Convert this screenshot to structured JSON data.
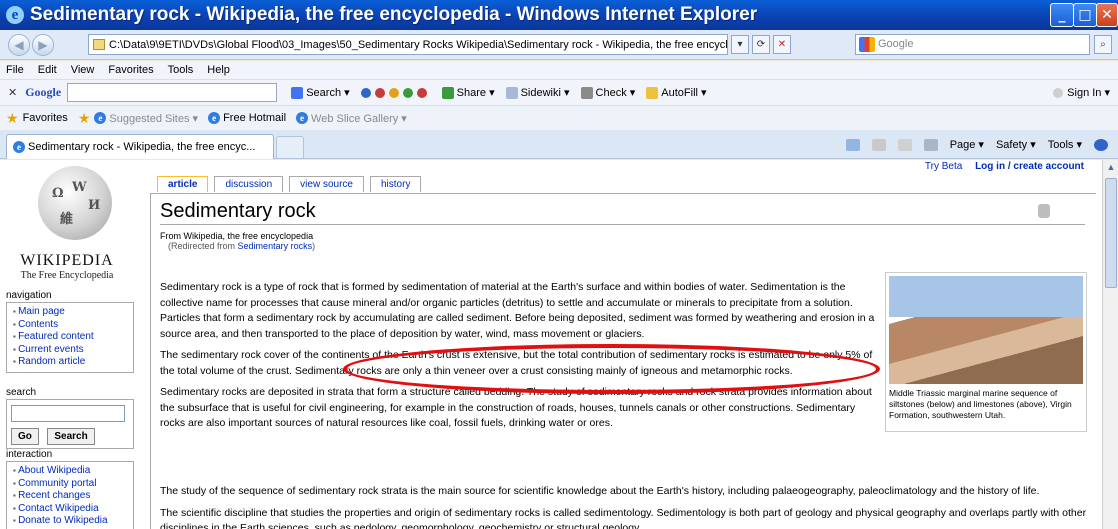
{
  "window": {
    "title": "Sedimentary rock - Wikipedia, the free encyclopedia - Windows Internet Explorer"
  },
  "address": {
    "url": "C:\\Data\\9\\9ETI\\DVDs\\Global Flood\\03_Images\\50_Sedimentary Rocks Wikipedia\\Sedimentary rock - Wikipedia, the free encyclopedia.mh",
    "search_placeholder": "Google"
  },
  "menu": [
    "File",
    "Edit",
    "View",
    "Favorites",
    "Tools",
    "Help"
  ],
  "google_toolbar": {
    "label": "Google",
    "items": [
      "Search ▾",
      "Share ▾",
      "Sidewiki ▾",
      "Check ▾",
      "AutoFill ▾",
      "Sign In ▾"
    ]
  },
  "favorites": {
    "label": "Favorites",
    "items": [
      "Suggested Sites ▾",
      "Free Hotmail",
      "Web Slice Gallery ▾"
    ]
  },
  "tab": {
    "title": "Sedimentary rock - Wikipedia, the free encyc..."
  },
  "commands": [
    "Page ▾",
    "Safety ▾",
    "Tools ▾"
  ],
  "wiki": {
    "wordmark": "WIKIPEDIA",
    "tagline": "The Free Encyclopedia",
    "navigation_title": "navigation",
    "navigation": [
      "Main page",
      "Contents",
      "Featured content",
      "Current events",
      "Random article"
    ],
    "search_title": "search",
    "go": "Go",
    "search": "Search",
    "interaction_title": "interaction",
    "interaction": [
      "About Wikipedia",
      "Community portal",
      "Recent changes",
      "Contact Wikipedia",
      "Donate to Wikipedia"
    ],
    "tabs": [
      "article",
      "discussion",
      "view source",
      "history"
    ],
    "try_beta": "Try Beta",
    "login": "Log in / create account",
    "title": "Sedimentary rock",
    "from": "From Wikipedia, the free encyclopedia",
    "redirect_prefix": "(Redirected from",
    "redirect_link": "Sedimentary rocks",
    "caption": "Middle Triassic marginal marine sequence of siltstones (below) and limestones (above), Virgin Formation, southwestern Utah.",
    "paragraphs": [
      "Sedimentary rock is a type of rock that is formed by sedimentation of material at the Earth's surface and within bodies of water. Sedimentation is the collective name for processes that cause mineral and/or organic particles (detritus) to settle and accumulate or minerals to precipitate from a solution. Particles that form a sedimentary rock by accumulating are called sediment. Before being deposited, sediment was formed by weathering and erosion in a source area, and then transported to the place of deposition by water, wind, mass movement or glaciers.",
      "The sedimentary rock cover of the continents of the Earth's crust is extensive, but the total contribution of sedimentary rocks is estimated to be only 5% of the total volume of the crust. Sedimentary rocks are only a thin veneer over a crust consisting mainly of igneous and metamorphic rocks.",
      "Sedimentary rocks are deposited in strata that form a structure called bedding. The study of sedimentary rocks and rock strata provides information about the subsurface that is useful for civil engineering, for example in the construction of roads, houses, tunnels canals or other constructions. Sedimentary rocks are also important sources of natural resources like coal, fossil fuels, drinking water or ores.",
      "The study of the sequence of sedimentary rock strata is the main source for scientific knowledge about the Earth's history, including palaeogeography, paleoclimatology and the history of life.",
      "The scientific discipline that studies the properties and origin of sedimentary rocks is called sedimentology. Sedimentology is both part of geology and physical geography and overlaps partly with other disciplines in the Earth sciences, such as pedology, geomorphology, geochemistry or structural geology."
    ]
  },
  "colors": {
    "titlebar": "#0b3fb0",
    "link": "#002bb8",
    "highlight_ellipse": "#e10f10"
  }
}
